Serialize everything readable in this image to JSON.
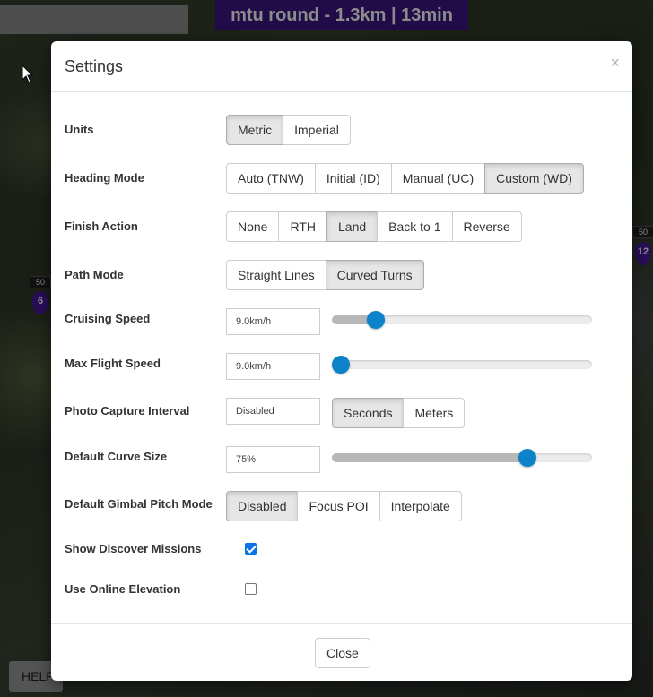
{
  "mission_title": "mtu round - 1.3km | 13min",
  "help_label": "HELP",
  "waypoints": [
    {
      "number": "6",
      "altitude": "50"
    },
    {
      "number": "12",
      "altitude": "50"
    }
  ],
  "modal": {
    "title": "Settings",
    "close_x": "×",
    "footer_close_label": "Close"
  },
  "settings": {
    "units": {
      "label": "Units",
      "options": [
        "Metric",
        "Imperial"
      ],
      "selected": "Metric"
    },
    "heading_mode": {
      "label": "Heading Mode",
      "options": [
        "Auto (TNW)",
        "Initial (ID)",
        "Manual (UC)",
        "Custom (WD)"
      ],
      "selected": "Custom (WD)"
    },
    "finish_action": {
      "label": "Finish Action",
      "options": [
        "None",
        "RTH",
        "Land",
        "Back to 1",
        "Reverse"
      ],
      "selected": "Land"
    },
    "path_mode": {
      "label": "Path Mode",
      "options": [
        "Straight Lines",
        "Curved Turns"
      ],
      "selected": "Curved Turns"
    },
    "cruising_speed": {
      "label": "Cruising Speed",
      "value": "9.0km/h",
      "slider_fraction": 0.17
    },
    "max_flight_speed": {
      "label": "Max Flight Speed",
      "value": "9.0km/h",
      "slider_fraction": 0.035
    },
    "photo_capture_interval": {
      "label": "Photo Capture Interval",
      "value": "Disabled",
      "options": [
        "Seconds",
        "Meters"
      ],
      "selected": "Seconds"
    },
    "default_curve_size": {
      "label": "Default Curve Size",
      "value": "75%",
      "slider_fraction": 0.75
    },
    "default_gimbal_pitch_mode": {
      "label": "Default Gimbal Pitch Mode",
      "options": [
        "Disabled",
        "Focus POI",
        "Interpolate"
      ],
      "selected": "Disabled"
    },
    "show_discover_missions": {
      "label": "Show Discover Missions",
      "checked": true
    },
    "use_online_elevation": {
      "label": "Use Online Elevation",
      "checked": false
    }
  },
  "colors": {
    "accent": "#0c83c9",
    "mission_banner": "#3d1483",
    "checkbox_checked": "#0b74e5"
  }
}
